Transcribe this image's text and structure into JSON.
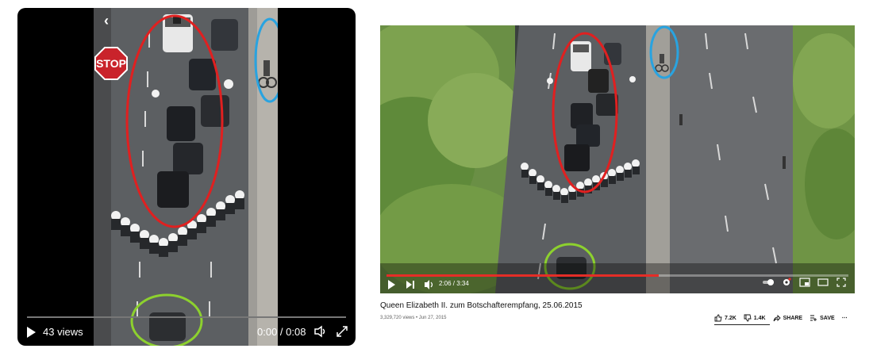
{
  "left_video": {
    "views_label": "43 views",
    "time_label": "0:00 / 0:08",
    "back_icon": "chevron-left-icon",
    "sign_text": "STOP"
  },
  "right_video": {
    "time_label": "2:06 / 3:34",
    "title": "Queen Elizabeth II. zum Botschafterempfang, 25.06.2015",
    "meta": "3,329,720 views • Jun 27, 2015",
    "actions": {
      "like": "7.2K",
      "dislike": "1.4K",
      "share": "SHARE",
      "save": "SAVE"
    },
    "progress_fraction": 0.59
  },
  "colors": {
    "red_annotation": "#e02020",
    "blue_annotation": "#29a3e0",
    "green_annotation": "#8dd12e",
    "progress": "#e52d27"
  }
}
